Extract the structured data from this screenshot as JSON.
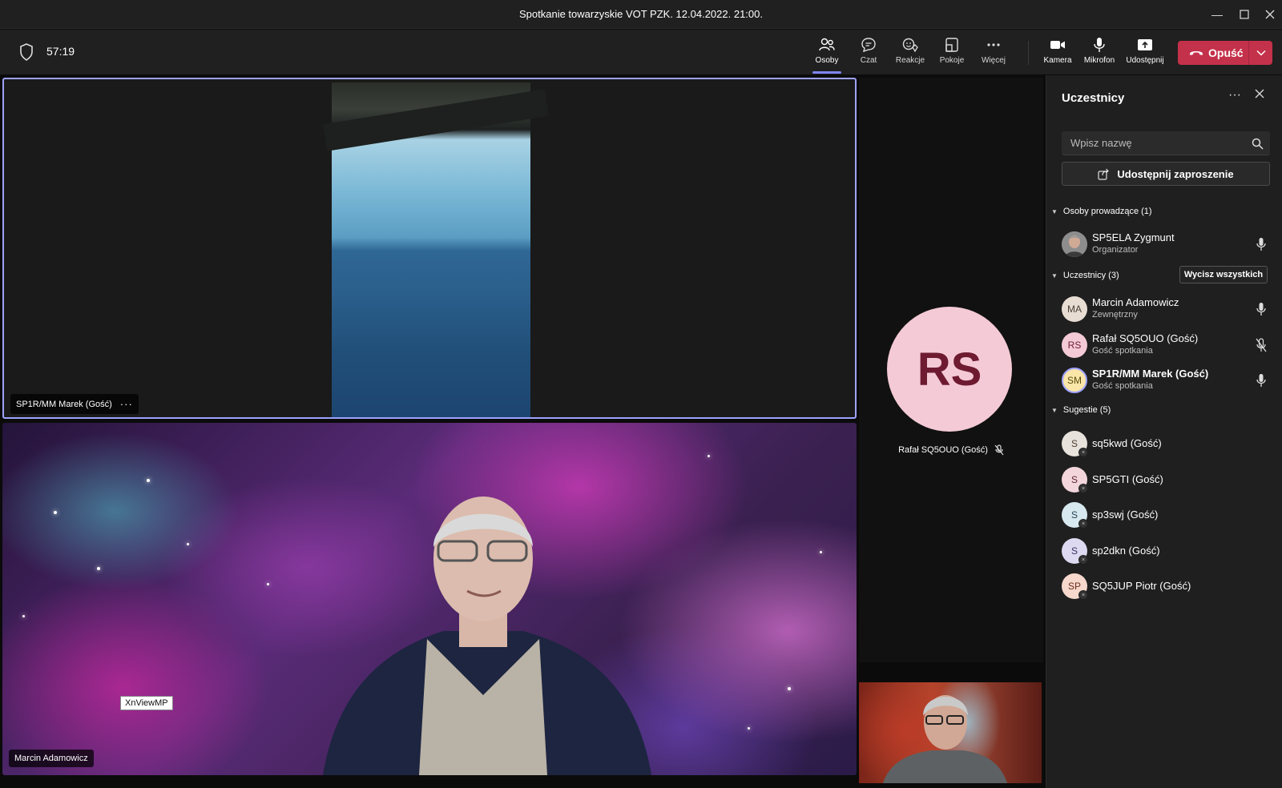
{
  "window": {
    "title": "Spotkanie towarzyskie VOT PZK. 12.04.2022. 21:00."
  },
  "meeting": {
    "timer": "57:19"
  },
  "toolbar": {
    "people_label": "Osoby",
    "chat_label": "Czat",
    "reactions_label": "Reakcje",
    "rooms_label": "Pokoje",
    "more_label": "Więcej",
    "camera_label": "Kamera",
    "mic_label": "Mikrofon",
    "share_label": "Udostępnij",
    "leave_label": "Opuść",
    "leave_color": "#c4314b",
    "accent_color": "#7f85f5"
  },
  "stage": {
    "tile1_name": "SP1R/MM Marek (Gość)",
    "tile2_name": "Marcin Adamowicz",
    "tooltip": "XnViewMP",
    "rs_initials": "RS",
    "rs_name": "Rafał SQ5OUO (Gość)"
  },
  "panel": {
    "title": "Uczestnicy",
    "search_placeholder": "Wpisz nazwę",
    "invite_label": "Udostępnij zaproszenie",
    "mute_all_label": "Wycisz wszystkich",
    "sections": {
      "presenters": "Osoby prowadzące (1)",
      "attendees": "Uczestnicy (3)",
      "suggestions": "Sugestie (5)"
    },
    "presenters": [
      {
        "name": "SP5ELA Zygmunt",
        "role": "Organizator"
      }
    ],
    "attendees": [
      {
        "initials": "MA",
        "name": "Marcin Adamowicz",
        "role": "Zewnętrzny"
      },
      {
        "initials": "RS",
        "name": "Rafał SQ5OUO (Gość)",
        "role": "Gość spotkania"
      },
      {
        "initials": "SM",
        "name": "SP1R/MM Marek (Gość)",
        "role": "Gość spotkania"
      }
    ],
    "suggestions": [
      {
        "initials": "S",
        "name": "sq5kwd (Gość)"
      },
      {
        "initials": "S",
        "name": "SP5GTI (Gość)"
      },
      {
        "initials": "S",
        "name": "sp3swj (Gość)"
      },
      {
        "initials": "S",
        "name": "sp2dkn (Gość)"
      },
      {
        "initials": "SP",
        "name": "SQ5JUP Piotr (Gość)"
      }
    ]
  }
}
